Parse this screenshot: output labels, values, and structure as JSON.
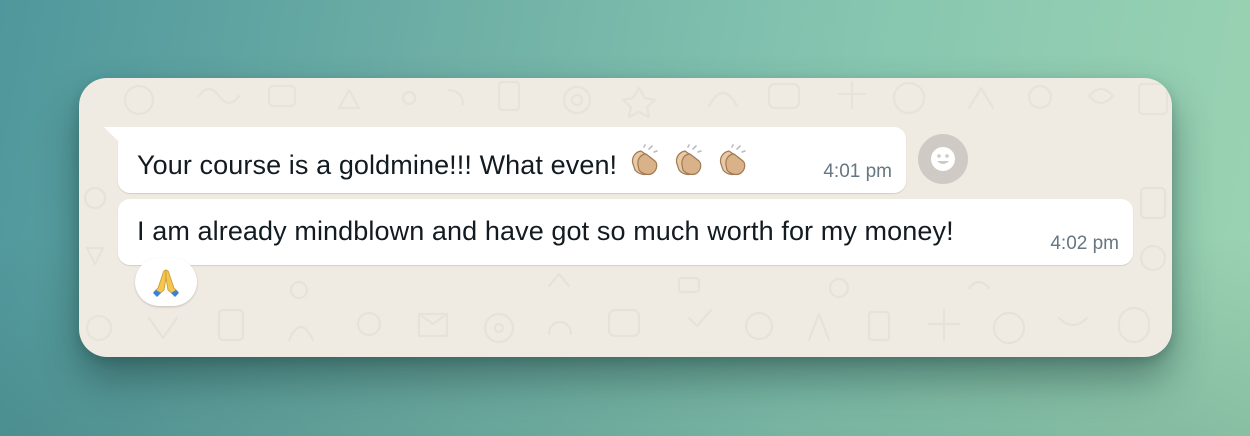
{
  "chat": {
    "messages": [
      {
        "text": "Your course is a goldmine!!! What even!",
        "emoji": [
          "clapping-hands-icon",
          "clapping-hands-icon",
          "clapping-hands-icon"
        ],
        "time": "4:01 pm"
      },
      {
        "text": "I am already mindblown and have got so much worth for my money!",
        "time": "4:02 pm",
        "reaction": "folded-hands-icon"
      }
    ],
    "react_button_icon": "smiley-icon"
  },
  "colors": {
    "bubble": "#ffffff",
    "wallpaper": "#efeae2",
    "text": "#111b21",
    "timestamp": "#667781",
    "react_button": "#cfcac3"
  }
}
